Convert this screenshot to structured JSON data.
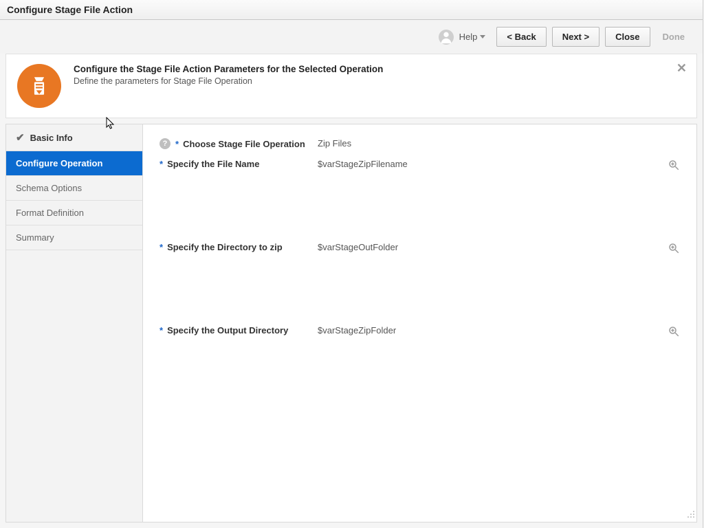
{
  "window_title": "Configure Stage File Action",
  "toolbar": {
    "help_label": "Help",
    "back_label": "<  Back",
    "next_label": "Next  >",
    "close_label": "Close",
    "done_label": "Done"
  },
  "banner": {
    "title": "Configure the Stage File Action Parameters for the Selected Operation",
    "subtitle": "Define the parameters for Stage File Operation"
  },
  "nav": {
    "items": [
      {
        "label": "Basic Info"
      },
      {
        "label": "Configure Operation"
      },
      {
        "label": "Schema Options"
      },
      {
        "label": "Format Definition"
      },
      {
        "label": "Summary"
      }
    ]
  },
  "form": {
    "operation_label": "Choose Stage File Operation",
    "operation_value": "Zip Files",
    "filename_label": "Specify the File Name",
    "filename_value": "$varStageZipFilename",
    "dir_zip_label": "Specify the Directory to zip",
    "dir_zip_value": "$varStageOutFolder",
    "out_dir_label": "Specify the Output Directory",
    "out_dir_value": "$varStageZipFolder"
  }
}
